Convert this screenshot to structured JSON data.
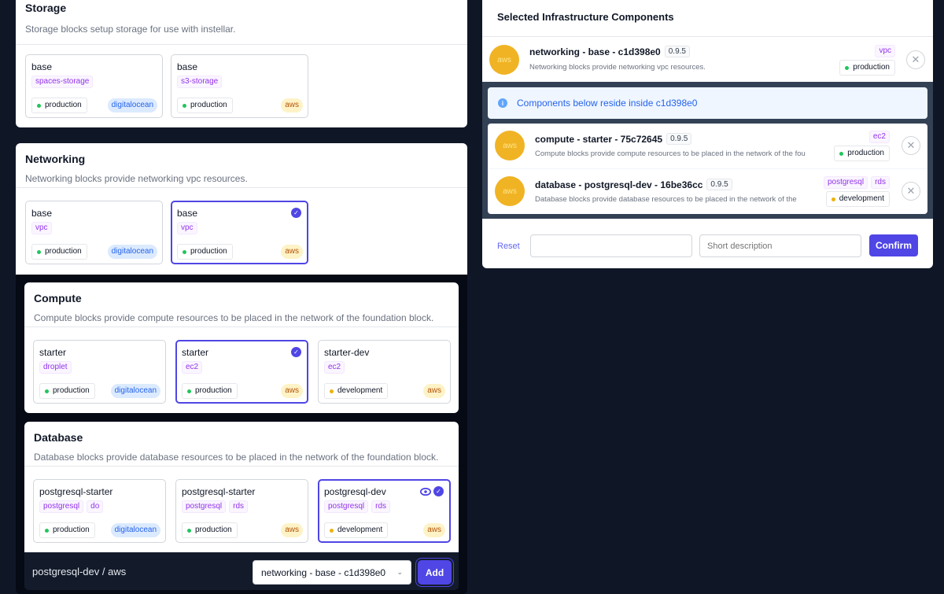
{
  "sections": {
    "storage": {
      "title": "Storage",
      "description": "Storage blocks setup storage for use with instellar.",
      "cards": [
        {
          "name": "base",
          "tags": [
            "spaces-storage"
          ],
          "environment": "production",
          "env_status": "green",
          "provider": "digitalocean",
          "selected": false
        },
        {
          "name": "base",
          "tags": [
            "s3-storage"
          ],
          "environment": "production",
          "env_status": "green",
          "provider": "aws",
          "selected": false
        }
      ]
    },
    "networking": {
      "title": "Networking",
      "description": "Networking blocks provide networking vpc resources.",
      "cards": [
        {
          "name": "base",
          "tags": [
            "vpc"
          ],
          "environment": "production",
          "env_status": "green",
          "provider": "digitalocean",
          "selected": false
        },
        {
          "name": "base",
          "tags": [
            "vpc"
          ],
          "environment": "production",
          "env_status": "green",
          "provider": "aws",
          "selected": true
        }
      ]
    },
    "compute": {
      "title": "Compute",
      "description": "Compute blocks provide compute resources to be placed in the network of the foundation block.",
      "cards": [
        {
          "name": "starter",
          "tags": [
            "droplet"
          ],
          "environment": "production",
          "env_status": "green",
          "provider": "digitalocean",
          "selected": false
        },
        {
          "name": "starter",
          "tags": [
            "ec2"
          ],
          "environment": "production",
          "env_status": "green",
          "provider": "aws",
          "selected": true
        },
        {
          "name": "starter-dev",
          "tags": [
            "ec2"
          ],
          "environment": "development",
          "env_status": "yellow",
          "provider": "aws",
          "selected": false
        }
      ]
    },
    "database": {
      "title": "Database",
      "description": "Database blocks provide database resources to be placed in the network of the foundation block.",
      "cards": [
        {
          "name": "postgresql-starter",
          "tags": [
            "postgresql",
            "do"
          ],
          "environment": "production",
          "env_status": "green",
          "provider": "digitalocean",
          "selected": false
        },
        {
          "name": "postgresql-starter",
          "tags": [
            "postgresql",
            "rds"
          ],
          "environment": "production",
          "env_status": "green",
          "provider": "aws",
          "selected": false
        },
        {
          "name": "postgresql-dev",
          "tags": [
            "postgresql",
            "rds"
          ],
          "environment": "development",
          "env_status": "yellow",
          "provider": "aws",
          "selected": true,
          "previewing": true
        }
      ]
    }
  },
  "bottom_bar": {
    "selection_label": "postgresql-dev / aws",
    "parent_select_value": "networking - base - c1d398e0",
    "add_label": "Add"
  },
  "selected_panel": {
    "title": "Selected Infrastructure Components",
    "root": {
      "avatar": "aws",
      "title": "networking - base - c1d398e0",
      "version": "0.9.5",
      "description": "Networking blocks provide networking vpc resources.",
      "tags": [
        "vpc"
      ],
      "environment": "production",
      "env_status": "green"
    },
    "info_message": "Components below reside inside c1d398e0",
    "children": [
      {
        "avatar": "aws",
        "title": "compute - starter - 75c72645",
        "version": "0.9.5",
        "description": "Compute blocks provide compute resources to be placed in the network of the fou",
        "tags": [
          "ec2"
        ],
        "environment": "production",
        "env_status": "green"
      },
      {
        "avatar": "aws",
        "title": "database - postgresql-dev - 16be36cc",
        "version": "0.9.5",
        "description": "Database blocks provide database resources to be placed in the network of the",
        "tags": [
          "postgresql",
          "rds"
        ],
        "environment": "development",
        "env_status": "yellow"
      }
    ],
    "footer": {
      "reset_label": "Reset",
      "name_input_value": "",
      "description_placeholder": "Short description",
      "confirm_label": "Confirm"
    }
  },
  "colors": {
    "accent": "#4f46e5",
    "background": "#0f1727",
    "aws_avatar": "#f0b324",
    "production": "#22c55e",
    "development": "#eab308"
  }
}
